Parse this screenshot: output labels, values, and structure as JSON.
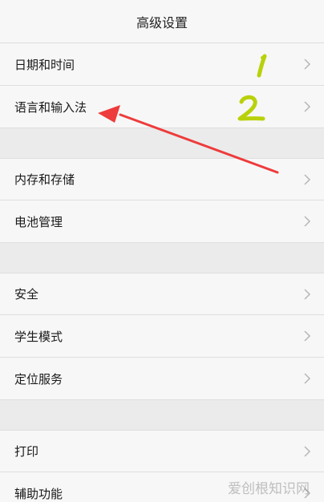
{
  "header": {
    "title": "高级设置"
  },
  "rows": [
    {
      "label": "日期和时间"
    },
    {
      "label": "语言和输入法"
    },
    {
      "label": "内存和存储"
    },
    {
      "label": "电池管理"
    },
    {
      "label": "安全"
    },
    {
      "label": "学生模式"
    },
    {
      "label": "定位服务"
    },
    {
      "label": "打印"
    },
    {
      "label": "辅助功能"
    }
  ],
  "annotations": {
    "number_1": "1",
    "number_2": "2",
    "marker_color": "#b9d10a",
    "arrow_color": "#ee3b3b"
  },
  "watermark": "爱创根知识网",
  "colors": {
    "row_bg": "#f7f7f7",
    "page_bg": "#ebebeb"
  }
}
